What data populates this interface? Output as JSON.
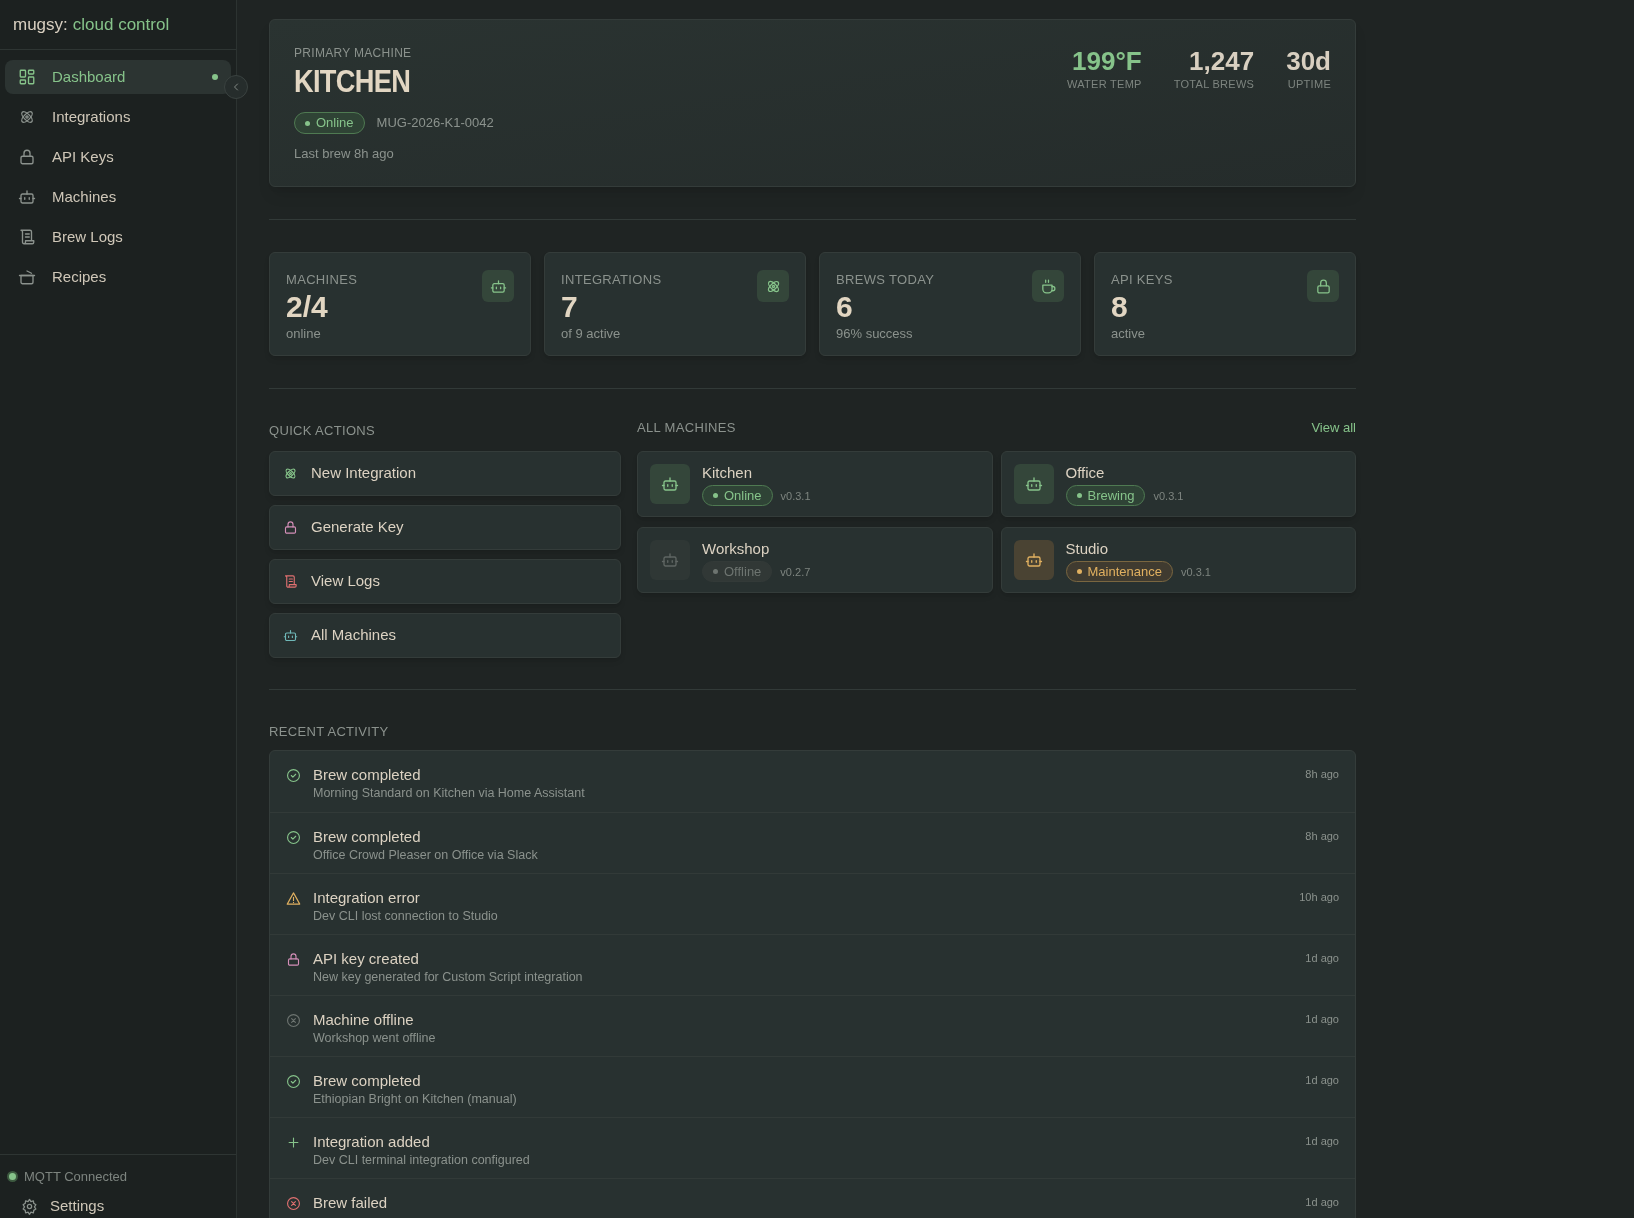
{
  "sidebar": {
    "brand": {
      "prefix": "mugsy:",
      "accent": "cloud control"
    },
    "items": [
      {
        "label": "Dashboard",
        "kind": "grid",
        "selected": true
      },
      {
        "label": "Integrations",
        "kind": "atom",
        "selected": false
      },
      {
        "label": "API Keys",
        "kind": "lock",
        "selected": false
      },
      {
        "label": "Machines",
        "kind": "robot",
        "selected": false
      },
      {
        "label": "Brew Logs",
        "kind": "scroll",
        "selected": false
      },
      {
        "label": "Recipes",
        "kind": "pot",
        "selected": false
      }
    ],
    "connection": {
      "label": "MQTT Connected",
      "on": true
    },
    "settings": "Settings"
  },
  "primary": {
    "eyebrow": "PRIMARY MACHINE",
    "name": "KITCHEN",
    "status": "Online",
    "serial": "MUG-2026-K1-0042",
    "last_brew": "Last brew 8h ago",
    "stats": [
      {
        "value": "199°F",
        "label": "WATER TEMP",
        "kind": "accent"
      },
      {
        "value": "1,247",
        "label": "TOTAL BREWS",
        "kind": "plain"
      },
      {
        "value": "30d",
        "label": "UPTIME",
        "kind": "plain"
      }
    ]
  },
  "summary": [
    {
      "label": "MACHINES",
      "value": "2/4",
      "sub": "online",
      "kind": "robot"
    },
    {
      "label": "INTEGRATIONS",
      "value": "7",
      "sub": "of 9 active",
      "kind": "atom"
    },
    {
      "label": "BREWS TODAY",
      "value": "6",
      "sub": "96% success",
      "kind": "cup"
    },
    {
      "label": "API KEYS",
      "value": "8",
      "sub": "active",
      "kind": "lock"
    }
  ],
  "quick_actions": {
    "title": "QUICK ACTIONS",
    "items": [
      {
        "label": "New Integration",
        "kind": "atom"
      },
      {
        "label": "Generate Key",
        "kind": "lock"
      },
      {
        "label": "View Logs",
        "kind": "scroll"
      },
      {
        "label": "All Machines",
        "kind": "robot"
      }
    ]
  },
  "machines": {
    "title": "ALL MACHINES",
    "link": "View all",
    "items": [
      {
        "name": "Kitchen",
        "status": "Online",
        "kind": "online",
        "version": "v0.3.1"
      },
      {
        "name": "Office",
        "status": "Brewing",
        "kind": "brewing",
        "version": "v0.3.1"
      },
      {
        "name": "Workshop",
        "status": "Offline",
        "kind": "offline",
        "version": "v0.2.7"
      },
      {
        "name": "Studio",
        "status": "Maintenance",
        "kind": "maintenance",
        "version": "v0.3.1"
      }
    ]
  },
  "activity": {
    "title": "RECENT ACTIVITY",
    "items": [
      {
        "kind": "success",
        "title": "Brew completed",
        "detail": "Morning Standard on Kitchen via Home Assistant",
        "time": "8h ago"
      },
      {
        "kind": "success",
        "title": "Brew completed",
        "detail": "Office Crowd Pleaser on Office via Slack",
        "time": "8h ago"
      },
      {
        "kind": "warning",
        "title": "Integration error",
        "detail": "Dev CLI lost connection to Studio",
        "time": "10h ago"
      },
      {
        "kind": "key",
        "title": "API key created",
        "detail": "New key generated for Custom Script integration",
        "time": "1d ago"
      },
      {
        "kind": "offline",
        "title": "Machine offline",
        "detail": "Workshop went offline",
        "time": "1d ago"
      },
      {
        "kind": "success",
        "title": "Brew completed",
        "detail": "Ethiopian Bright on Kitchen (manual)",
        "time": "1d ago"
      },
      {
        "kind": "added",
        "title": "Integration added",
        "detail": "Dev CLI terminal integration configured",
        "time": "1d ago"
      },
      {
        "kind": "failed",
        "title": "Brew failed",
        "time": "1d ago"
      }
    ]
  }
}
